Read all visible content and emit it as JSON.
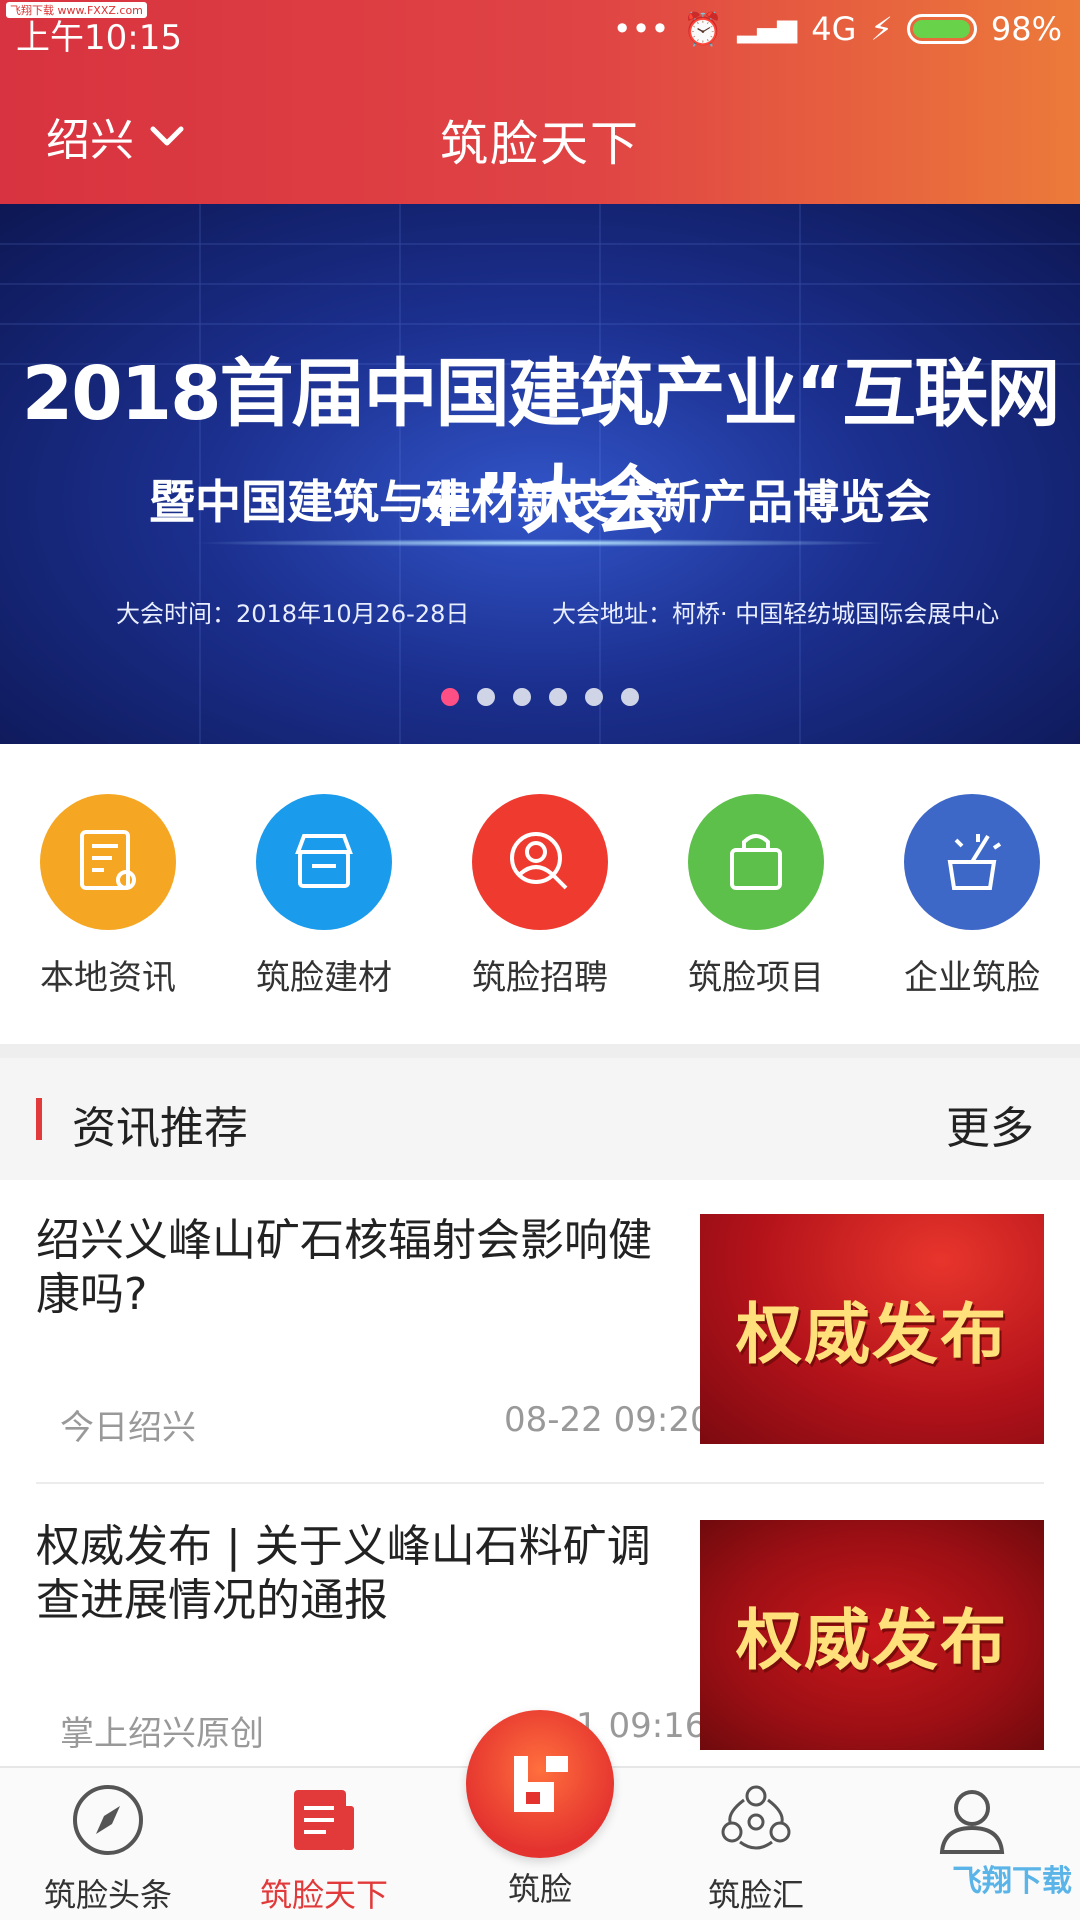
{
  "status_bar": {
    "time": "上午10:15",
    "network": "4G",
    "battery": "98%",
    "brand_tag": "飞翔下载 www.FXXZ.com",
    "battery_level": 0.98,
    "battery_color": "#68d24a"
  },
  "header": {
    "city": "绍兴",
    "title": "筑脸天下"
  },
  "banner": {
    "line1": "2018首届中国建筑产业“互联网+”大会",
    "line2": "暨中国建筑与建材新技术新产品博览会",
    "time_info": "大会时间：2018年10月26-28日",
    "place_info": "大会地址：柯桥· 中国轻纺城国际会展中心",
    "dots_total": 6,
    "active_dot": 0
  },
  "shortcuts": [
    {
      "label": "本地资讯",
      "icon": "local-news-icon",
      "color": "#f5a623"
    },
    {
      "label": "筑脸建材",
      "icon": "building-materials-icon",
      "color": "#1a9bec"
    },
    {
      "label": "筑脸招聘",
      "icon": "recruitment-icon",
      "color": "#ef3b2f"
    },
    {
      "label": "筑脸项目",
      "icon": "project-bag-icon",
      "color": "#5cc04a"
    },
    {
      "label": "企业筑脸",
      "icon": "enterprise-magic-icon",
      "color": "#3e68c7"
    }
  ],
  "section": {
    "title": "资讯推荐",
    "more": "更多"
  },
  "news": [
    {
      "title": "绍兴义峰山矿石核辐射会影响健康吗?",
      "source": "今日绍兴",
      "date": "08-22 09:20",
      "thumb_text": "权威发布"
    },
    {
      "title": "权威发布 | 关于义峰山石料矿调查进展情况的通报",
      "source": "掌上绍兴原创",
      "date": "1 09:16",
      "thumb_text": "权威发布"
    }
  ],
  "bottom_nav": [
    {
      "label": "筑脸头条",
      "icon": "compass-icon"
    },
    {
      "label": "筑脸天下",
      "icon": "newspaper-icon",
      "active": true
    },
    {
      "label": "筑脸",
      "icon": "zhulian-logo-icon"
    },
    {
      "label": "筑脸汇",
      "icon": "community-icon"
    },
    {
      "label": "",
      "icon": "profile-icon"
    }
  ],
  "watermark": "飞翔下载",
  "colors": {
    "accent": "#e23a3a",
    "header_start": "#d83340",
    "header_end": "#ec7a3a"
  }
}
